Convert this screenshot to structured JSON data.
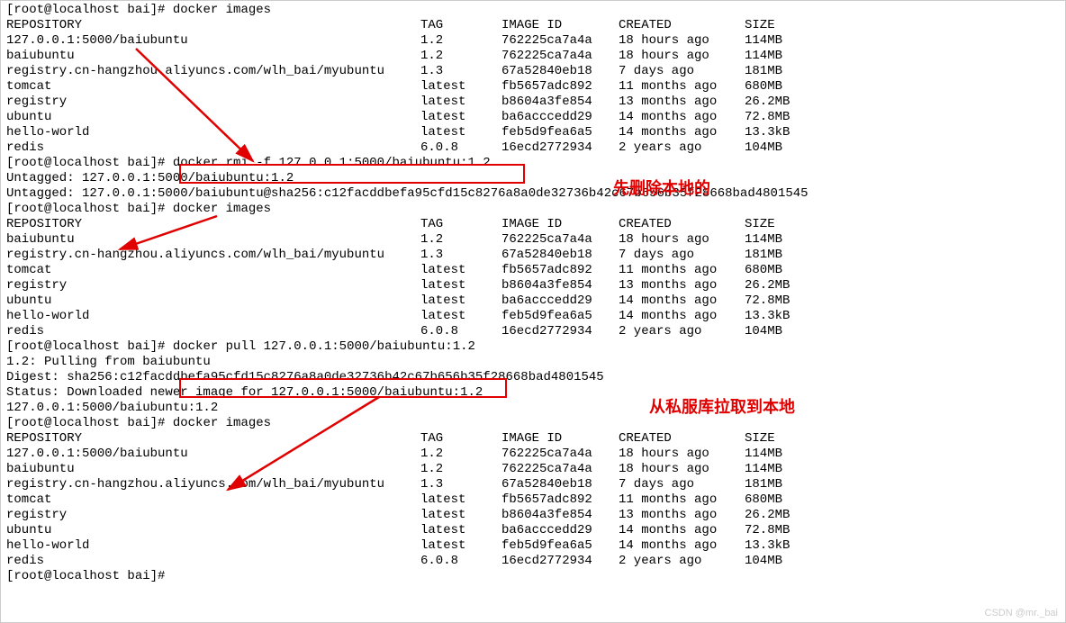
{
  "prompt": "[root@localhost bai]# ",
  "cmd_images": "docker images",
  "cmd_rmi": "docker rmi -f 127.0.0.1:5000/baiubuntu:1.2",
  "cmd_pull": "docker pull 127.0.0.1:5000/baiubuntu:1.2",
  "untagged1": "Untagged: 127.0.0.1:5000/baiubuntu:1.2",
  "untagged2": "Untagged: 127.0.0.1:5000/baiubuntu@sha256:c12facddbefa95cfd15c8276a8a0de32736b42c67b656b35f28668bad4801545",
  "pulling": "1.2: Pulling from baiubuntu",
  "digest": "Digest: sha256:c12facddbefa95cfd15c8276a8a0de32736b42c67b656b35f28668bad4801545",
  "status": "Status: Downloaded newer image for 127.0.0.1:5000/baiubuntu:1.2",
  "imgref": "127.0.0.1:5000/baiubuntu:1.2",
  "headers": {
    "repo": "REPOSITORY",
    "tag": "TAG",
    "image": "IMAGE ID",
    "created": "CREATED",
    "size": "SIZE"
  },
  "table1": [
    {
      "repo": "127.0.0.1:5000/baiubuntu",
      "tag": "1.2",
      "image": "762225ca7a4a",
      "created": "18 hours ago",
      "size": "114MB"
    },
    {
      "repo": "baiubuntu",
      "tag": "1.2",
      "image": "762225ca7a4a",
      "created": "18 hours ago",
      "size": "114MB"
    },
    {
      "repo": "registry.cn-hangzhou.aliyuncs.com/wlh_bai/myubuntu",
      "tag": "1.3",
      "image": "67a52840eb18",
      "created": "7 days ago",
      "size": "181MB"
    },
    {
      "repo": "tomcat",
      "tag": "latest",
      "image": "fb5657adc892",
      "created": "11 months ago",
      "size": "680MB"
    },
    {
      "repo": "registry",
      "tag": "latest",
      "image": "b8604a3fe854",
      "created": "13 months ago",
      "size": "26.2MB"
    },
    {
      "repo": "ubuntu",
      "tag": "latest",
      "image": "ba6acccedd29",
      "created": "14 months ago",
      "size": "72.8MB"
    },
    {
      "repo": "hello-world",
      "tag": "latest",
      "image": "feb5d9fea6a5",
      "created": "14 months ago",
      "size": "13.3kB"
    },
    {
      "repo": "redis",
      "tag": "6.0.8",
      "image": "16ecd2772934",
      "created": "2 years ago",
      "size": "104MB"
    }
  ],
  "table2": [
    {
      "repo": "baiubuntu",
      "tag": "1.2",
      "image": "762225ca7a4a",
      "created": "18 hours ago",
      "size": "114MB"
    },
    {
      "repo": "registry.cn-hangzhou.aliyuncs.com/wlh_bai/myubuntu",
      "tag": "1.3",
      "image": "67a52840eb18",
      "created": "7 days ago",
      "size": "181MB"
    },
    {
      "repo": "tomcat",
      "tag": "latest",
      "image": "fb5657adc892",
      "created": "11 months ago",
      "size": "680MB"
    },
    {
      "repo": "registry",
      "tag": "latest",
      "image": "b8604a3fe854",
      "created": "13 months ago",
      "size": "26.2MB"
    },
    {
      "repo": "ubuntu",
      "tag": "latest",
      "image": "ba6acccedd29",
      "created": "14 months ago",
      "size": "72.8MB"
    },
    {
      "repo": "hello-world",
      "tag": "latest",
      "image": "feb5d9fea6a5",
      "created": "14 months ago",
      "size": "13.3kB"
    },
    {
      "repo": "redis",
      "tag": "6.0.8",
      "image": "16ecd2772934",
      "created": "2 years ago",
      "size": "104MB"
    }
  ],
  "table3": [
    {
      "repo": "127.0.0.1:5000/baiubuntu",
      "tag": "1.2",
      "image": "762225ca7a4a",
      "created": "18 hours ago",
      "size": "114MB"
    },
    {
      "repo": "baiubuntu",
      "tag": "1.2",
      "image": "762225ca7a4a",
      "created": "18 hours ago",
      "size": "114MB"
    },
    {
      "repo": "registry.cn-hangzhou.aliyuncs.com/wlh_bai/myubuntu",
      "tag": "1.3",
      "image": "67a52840eb18",
      "created": "7 days ago",
      "size": "181MB"
    },
    {
      "repo": "tomcat",
      "tag": "latest",
      "image": "fb5657adc892",
      "created": "11 months ago",
      "size": "680MB"
    },
    {
      "repo": "registry",
      "tag": "latest",
      "image": "b8604a3fe854",
      "created": "13 months ago",
      "size": "26.2MB"
    },
    {
      "repo": "ubuntu",
      "tag": "latest",
      "image": "ba6acccedd29",
      "created": "14 months ago",
      "size": "72.8MB"
    },
    {
      "repo": "hello-world",
      "tag": "latest",
      "image": "feb5d9fea6a5",
      "created": "14 months ago",
      "size": "13.3kB"
    },
    {
      "repo": "redis",
      "tag": "6.0.8",
      "image": "16ecd2772934",
      "created": "2 years ago",
      "size": "104MB"
    }
  ],
  "anno1": "先删除本地的",
  "anno2": "从私服库拉取到本地",
  "watermark": "CSDN @mr._bai"
}
